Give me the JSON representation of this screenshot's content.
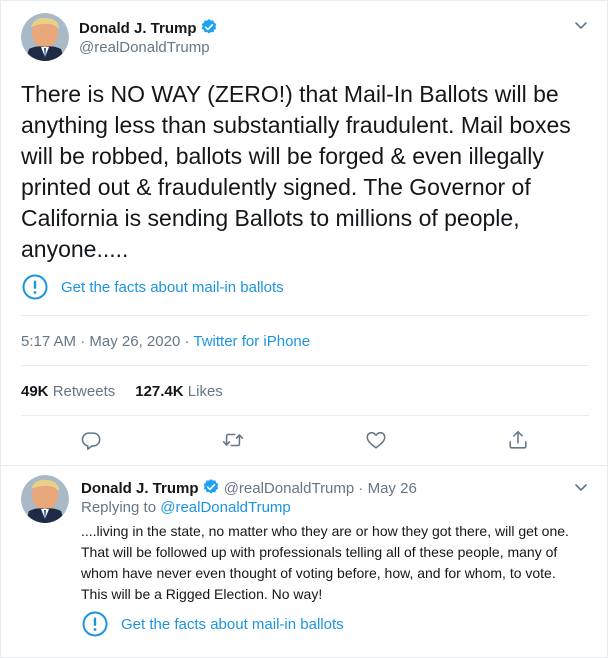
{
  "main_tweet": {
    "author_name": "Donald J. Trump",
    "author_handle": "@realDonaldTrump",
    "verified": true,
    "text": "There is NO WAY (ZERO!) that Mail-In Ballots will be anything less than substantially fraudulent. Mail boxes will be robbed, ballots will be forged & even illegally printed out & fraudulently signed. The Governor of California is sending Ballots to millions of people, anyone.....",
    "fact_check_label": "Get the facts about mail-in ballots",
    "time": "5:17 AM",
    "date": "May 26, 2020",
    "source": "Twitter for iPhone",
    "retweets_count": "49K",
    "retweets_label": "Retweets",
    "likes_count": "127.4K",
    "likes_label": "Likes"
  },
  "reply_tweet": {
    "author_name": "Donald J. Trump",
    "author_handle": "@realDonaldTrump",
    "date": "May 26",
    "replying_to_label": "Replying to",
    "replying_to_handle": "@realDonaldTrump",
    "text": "....living in the state, no matter who they are or how they got there, will get one. That will be followed up with professionals telling all of these people, many of whom have never even thought of voting before, how, and for whom, to vote. This will be a Rigged Election. No way!",
    "fact_check_label": "Get the facts about mail-in ballots"
  },
  "icons": {
    "verified": "verified-badge-icon",
    "chevron": "chevron-down-icon",
    "fact_check": "exclamation-circle-icon",
    "reply": "reply-icon",
    "retweet": "retweet-icon",
    "like": "heart-icon",
    "share": "share-icon"
  },
  "colors": {
    "link_blue": "#1b95e0",
    "verified_blue": "#1da1f2",
    "secondary_text": "#657786",
    "primary_text": "#14171a",
    "divider": "#e6ecf0"
  }
}
